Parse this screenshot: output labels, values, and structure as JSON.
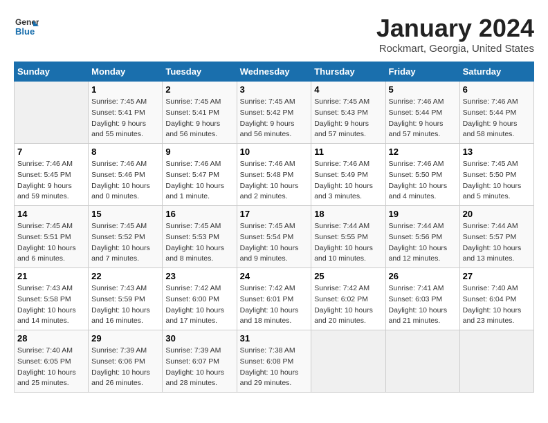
{
  "header": {
    "logo_line1": "General",
    "logo_line2": "Blue",
    "title": "January 2024",
    "subtitle": "Rockmart, Georgia, United States"
  },
  "days_of_week": [
    "Sunday",
    "Monday",
    "Tuesday",
    "Wednesday",
    "Thursday",
    "Friday",
    "Saturday"
  ],
  "weeks": [
    [
      {
        "day": "",
        "info": ""
      },
      {
        "day": "1",
        "info": "Sunrise: 7:45 AM\nSunset: 5:41 PM\nDaylight: 9 hours\nand 55 minutes."
      },
      {
        "day": "2",
        "info": "Sunrise: 7:45 AM\nSunset: 5:41 PM\nDaylight: 9 hours\nand 56 minutes."
      },
      {
        "day": "3",
        "info": "Sunrise: 7:45 AM\nSunset: 5:42 PM\nDaylight: 9 hours\nand 56 minutes."
      },
      {
        "day": "4",
        "info": "Sunrise: 7:45 AM\nSunset: 5:43 PM\nDaylight: 9 hours\nand 57 minutes."
      },
      {
        "day": "5",
        "info": "Sunrise: 7:46 AM\nSunset: 5:44 PM\nDaylight: 9 hours\nand 57 minutes."
      },
      {
        "day": "6",
        "info": "Sunrise: 7:46 AM\nSunset: 5:44 PM\nDaylight: 9 hours\nand 58 minutes."
      }
    ],
    [
      {
        "day": "7",
        "info": "Sunrise: 7:46 AM\nSunset: 5:45 PM\nDaylight: 9 hours\nand 59 minutes."
      },
      {
        "day": "8",
        "info": "Sunrise: 7:46 AM\nSunset: 5:46 PM\nDaylight: 10 hours\nand 0 minutes."
      },
      {
        "day": "9",
        "info": "Sunrise: 7:46 AM\nSunset: 5:47 PM\nDaylight: 10 hours\nand 1 minute."
      },
      {
        "day": "10",
        "info": "Sunrise: 7:46 AM\nSunset: 5:48 PM\nDaylight: 10 hours\nand 2 minutes."
      },
      {
        "day": "11",
        "info": "Sunrise: 7:46 AM\nSunset: 5:49 PM\nDaylight: 10 hours\nand 3 minutes."
      },
      {
        "day": "12",
        "info": "Sunrise: 7:46 AM\nSunset: 5:50 PM\nDaylight: 10 hours\nand 4 minutes."
      },
      {
        "day": "13",
        "info": "Sunrise: 7:45 AM\nSunset: 5:50 PM\nDaylight: 10 hours\nand 5 minutes."
      }
    ],
    [
      {
        "day": "14",
        "info": "Sunrise: 7:45 AM\nSunset: 5:51 PM\nDaylight: 10 hours\nand 6 minutes."
      },
      {
        "day": "15",
        "info": "Sunrise: 7:45 AM\nSunset: 5:52 PM\nDaylight: 10 hours\nand 7 minutes."
      },
      {
        "day": "16",
        "info": "Sunrise: 7:45 AM\nSunset: 5:53 PM\nDaylight: 10 hours\nand 8 minutes."
      },
      {
        "day": "17",
        "info": "Sunrise: 7:45 AM\nSunset: 5:54 PM\nDaylight: 10 hours\nand 9 minutes."
      },
      {
        "day": "18",
        "info": "Sunrise: 7:44 AM\nSunset: 5:55 PM\nDaylight: 10 hours\nand 10 minutes."
      },
      {
        "day": "19",
        "info": "Sunrise: 7:44 AM\nSunset: 5:56 PM\nDaylight: 10 hours\nand 12 minutes."
      },
      {
        "day": "20",
        "info": "Sunrise: 7:44 AM\nSunset: 5:57 PM\nDaylight: 10 hours\nand 13 minutes."
      }
    ],
    [
      {
        "day": "21",
        "info": "Sunrise: 7:43 AM\nSunset: 5:58 PM\nDaylight: 10 hours\nand 14 minutes."
      },
      {
        "day": "22",
        "info": "Sunrise: 7:43 AM\nSunset: 5:59 PM\nDaylight: 10 hours\nand 16 minutes."
      },
      {
        "day": "23",
        "info": "Sunrise: 7:42 AM\nSunset: 6:00 PM\nDaylight: 10 hours\nand 17 minutes."
      },
      {
        "day": "24",
        "info": "Sunrise: 7:42 AM\nSunset: 6:01 PM\nDaylight: 10 hours\nand 18 minutes."
      },
      {
        "day": "25",
        "info": "Sunrise: 7:42 AM\nSunset: 6:02 PM\nDaylight: 10 hours\nand 20 minutes."
      },
      {
        "day": "26",
        "info": "Sunrise: 7:41 AM\nSunset: 6:03 PM\nDaylight: 10 hours\nand 21 minutes."
      },
      {
        "day": "27",
        "info": "Sunrise: 7:40 AM\nSunset: 6:04 PM\nDaylight: 10 hours\nand 23 minutes."
      }
    ],
    [
      {
        "day": "28",
        "info": "Sunrise: 7:40 AM\nSunset: 6:05 PM\nDaylight: 10 hours\nand 25 minutes."
      },
      {
        "day": "29",
        "info": "Sunrise: 7:39 AM\nSunset: 6:06 PM\nDaylight: 10 hours\nand 26 minutes."
      },
      {
        "day": "30",
        "info": "Sunrise: 7:39 AM\nSunset: 6:07 PM\nDaylight: 10 hours\nand 28 minutes."
      },
      {
        "day": "31",
        "info": "Sunrise: 7:38 AM\nSunset: 6:08 PM\nDaylight: 10 hours\nand 29 minutes."
      },
      {
        "day": "",
        "info": ""
      },
      {
        "day": "",
        "info": ""
      },
      {
        "day": "",
        "info": ""
      }
    ]
  ]
}
